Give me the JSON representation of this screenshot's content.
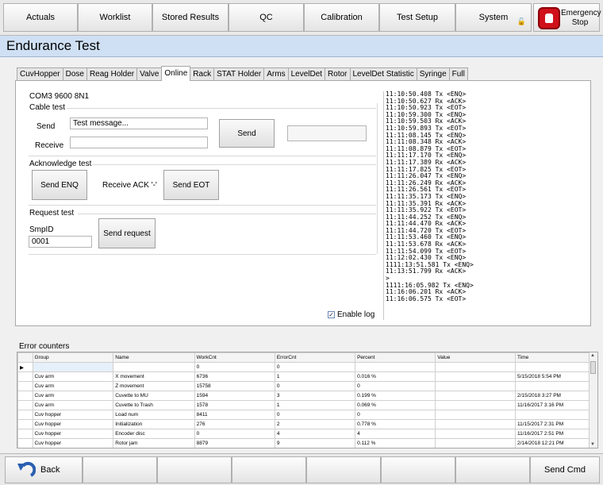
{
  "nav": {
    "actuals": "Actuals",
    "worklist": "Worklist",
    "stored_results": "Stored Results",
    "qc": "QC",
    "calibration": "Calibration",
    "test_setup": "Test Setup",
    "system": "System",
    "emergency_stop": "Emergency Stop"
  },
  "page_title": "Endurance Test",
  "tabs": [
    "CuvHopper",
    "Dose",
    "Reag Holder",
    "Valve",
    "Online",
    "Rack",
    "STAT Holder",
    "Arms",
    "LevelDet",
    "Rotor",
    "LevelDet Statistic",
    "Syringe",
    "Full"
  ],
  "active_tab": "Online",
  "online": {
    "port_settings": "COM3 9600 8N1",
    "cable_test": {
      "title": "Cable test",
      "send_label": "Send",
      "send_value": "Test message...",
      "receive_label": "Receive",
      "receive_value": "",
      "send_button": "Send",
      "result_value": ""
    },
    "ack_test": {
      "title": "Acknowledge test",
      "send_enq_button": "Send ENQ",
      "receive_ack_label": "Receive ACK '-'",
      "send_eot_button": "Send EOT"
    },
    "request_test": {
      "title": "Request test",
      "smpid_label": "SmpID",
      "smpid_value": "0001",
      "send_request_button": "Send request"
    },
    "enable_log_label": "Enable log",
    "enable_log_checked": true,
    "log_text": "11:10:50.408 Tx <ENQ>\n11:10:50.627 Rx <ACK>\n11:10:50.923 Tx <EOT>\n11:10:59.300 Tx <ENQ>\n11:10:59.503 Rx <ACK>\n11:10:59.893 Tx <EOT>\n11:11:08.145 Tx <ENQ>\n11:11:08.348 Rx <ACK>\n11:11:08.879 Tx <EOT>\n11:11:17.170 Tx <ENQ>\n11:11:17.389 Rx <ACK>\n11:11:17.825 Tx <EOT>\n11:11:26.047 Tx <ENQ>\n11:11:26.249 Rx <ACK>\n11:11:26.561 Tx <EOT>\n11:11:35.173 Tx <ENQ>\n11:11:35.391 Rx <ACK>\n11:11:35.922 Tx <EOT>\n11:11:44.252 Tx <ENQ>\n11:11:44.470 Rx <ACK>\n11:11:44.720 Tx <EOT>\n11:11:53.460 Tx <ENQ>\n11:11:53.678 Rx <ACK>\n11:11:54.099 Tx <EOT>\n11:12:02.430 Tx <ENQ>\n1111:13:51.581 Tx <ENQ>\n11:13:51.799 Rx <ACK>\n>\n1111:16:05.982 Tx <ENQ>\n11:16:06.201 Rx <ACK>\n11:16:06.575 Tx <EOT>"
  },
  "error_counters": {
    "title": "Error counters",
    "columns": [
      "Group",
      "Name",
      "WorkCnt",
      "ErrorCnt",
      "Percent",
      "Value",
      "Time"
    ],
    "rows": [
      [
        "",
        "",
        "0",
        "0",
        "",
        "",
        ""
      ],
      [
        "Cuv arm",
        "X movement",
        "6736",
        "1",
        "0.016 %",
        "",
        "5/15/2018 5:54 PM"
      ],
      [
        "Cuv arm",
        "Z movement",
        "15758",
        "0",
        "0",
        "",
        ""
      ],
      [
        "Cuv arm",
        "Cuvette to MU",
        "1594",
        "3",
        "0.199 %",
        "",
        "2/15/2018 3:27 PM"
      ],
      [
        "Cuv arm",
        "Cuvette to Trash",
        "1578",
        "1",
        "0.069 %",
        "",
        "11/16/2017 3:16 PM"
      ],
      [
        "Cuv hopper",
        "Load num",
        "8411",
        "0",
        "0",
        "",
        ""
      ],
      [
        "Cuv hopper",
        "Initialization",
        "276",
        "2",
        "0.778 %",
        "",
        "11/15/2017 2:31 PM"
      ],
      [
        "Cuv hopper",
        "Encoder disc",
        "0",
        "4",
        "4",
        "",
        "11/16/2017 2:51 PM"
      ],
      [
        "Cuv hopper",
        "Rotor jam",
        "8879",
        "9",
        "0.112 %",
        "",
        "2/14/2018 12:21 PM"
      ]
    ]
  },
  "footer": {
    "back_label": "Back",
    "send_cmd_label": "Send Cmd"
  }
}
